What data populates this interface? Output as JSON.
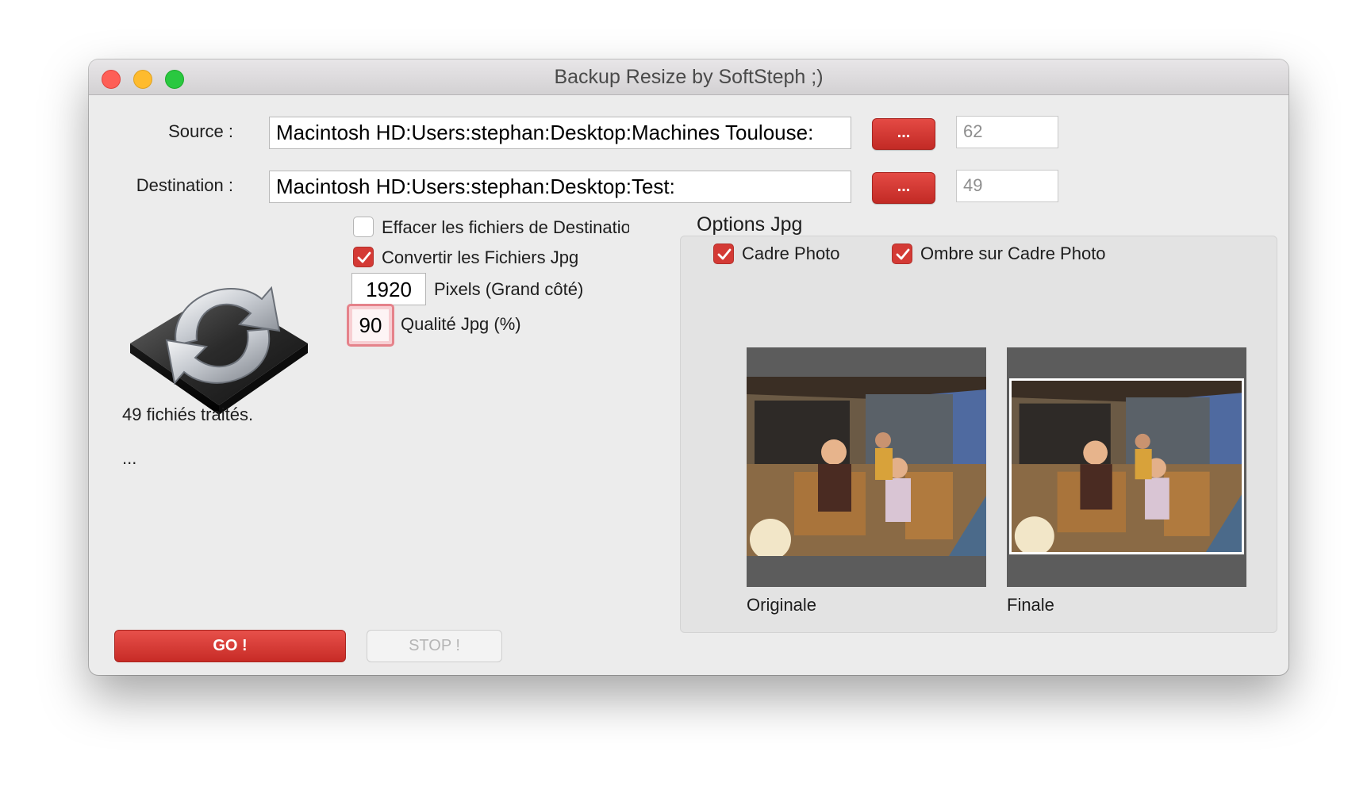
{
  "window": {
    "title": "Backup Resize by SoftSteph ;)"
  },
  "source": {
    "label": "Source :",
    "path": "Macintosh HD:Users:stephan:Desktop:Machines Toulouse:",
    "browse_label": "...",
    "count": "62"
  },
  "destination": {
    "label": "Destination :",
    "path": "Macintosh HD:Users:stephan:Desktop:Test:",
    "browse_label": "...",
    "count": "49"
  },
  "options": {
    "erase_dest": {
      "label": "Effacer les fichiers de Destinatio",
      "checked": false
    },
    "convert_jpg": {
      "label": "Convertir les Fichiers Jpg",
      "checked": true
    },
    "pixels": {
      "value": "1920",
      "label": "Pixels (Grand côté)"
    },
    "quality": {
      "value": "90",
      "label": "Qualité Jpg (%)"
    }
  },
  "status": {
    "processed": "49 fichiés traités.",
    "detail": "..."
  },
  "buttons": {
    "go": "GO !",
    "stop": "STOP !"
  },
  "jpg_options": {
    "title": "Options Jpg",
    "photo_frame": {
      "label": "Cadre Photo",
      "checked": true
    },
    "frame_shadow": {
      "label": "Ombre sur Cadre Photo",
      "checked": true
    },
    "original_label": "Originale",
    "final_label": "Finale"
  },
  "colors": {
    "accent": "#d43a35",
    "preview_bg": "#5c5c5c"
  }
}
